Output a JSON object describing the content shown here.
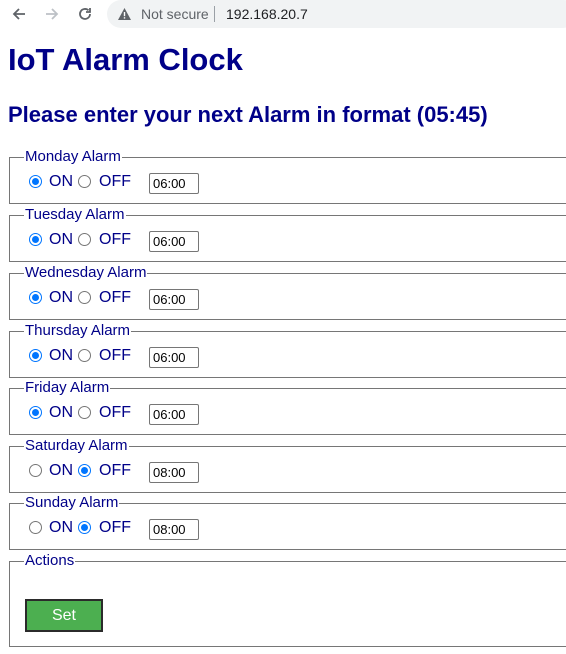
{
  "browser": {
    "security_label": "Not secure",
    "url": "192.168.20.7"
  },
  "page": {
    "title": "IoT Alarm Clock",
    "subtitle": "Please enter your next Alarm in format (05:45)"
  },
  "labels": {
    "on": "ON",
    "off": "OFF"
  },
  "alarms": [
    {
      "legend": "Monday Alarm",
      "enabled": true,
      "time": "06:00"
    },
    {
      "legend": "Tuesday Alarm",
      "enabled": true,
      "time": "06:00"
    },
    {
      "legend": "Wednesday Alarm",
      "enabled": true,
      "time": "06:00"
    },
    {
      "legend": "Thursday Alarm",
      "enabled": true,
      "time": "06:00"
    },
    {
      "legend": "Friday Alarm",
      "enabled": true,
      "time": "06:00"
    },
    {
      "legend": "Saturday Alarm",
      "enabled": false,
      "time": "08:00"
    },
    {
      "legend": "Sunday Alarm",
      "enabled": false,
      "time": "08:00"
    }
  ],
  "actions": {
    "legend": "Actions",
    "set_label": "Set"
  },
  "colors": {
    "heading": "#000088",
    "button": "#4caf50",
    "radio_checked": "#0075ff"
  }
}
